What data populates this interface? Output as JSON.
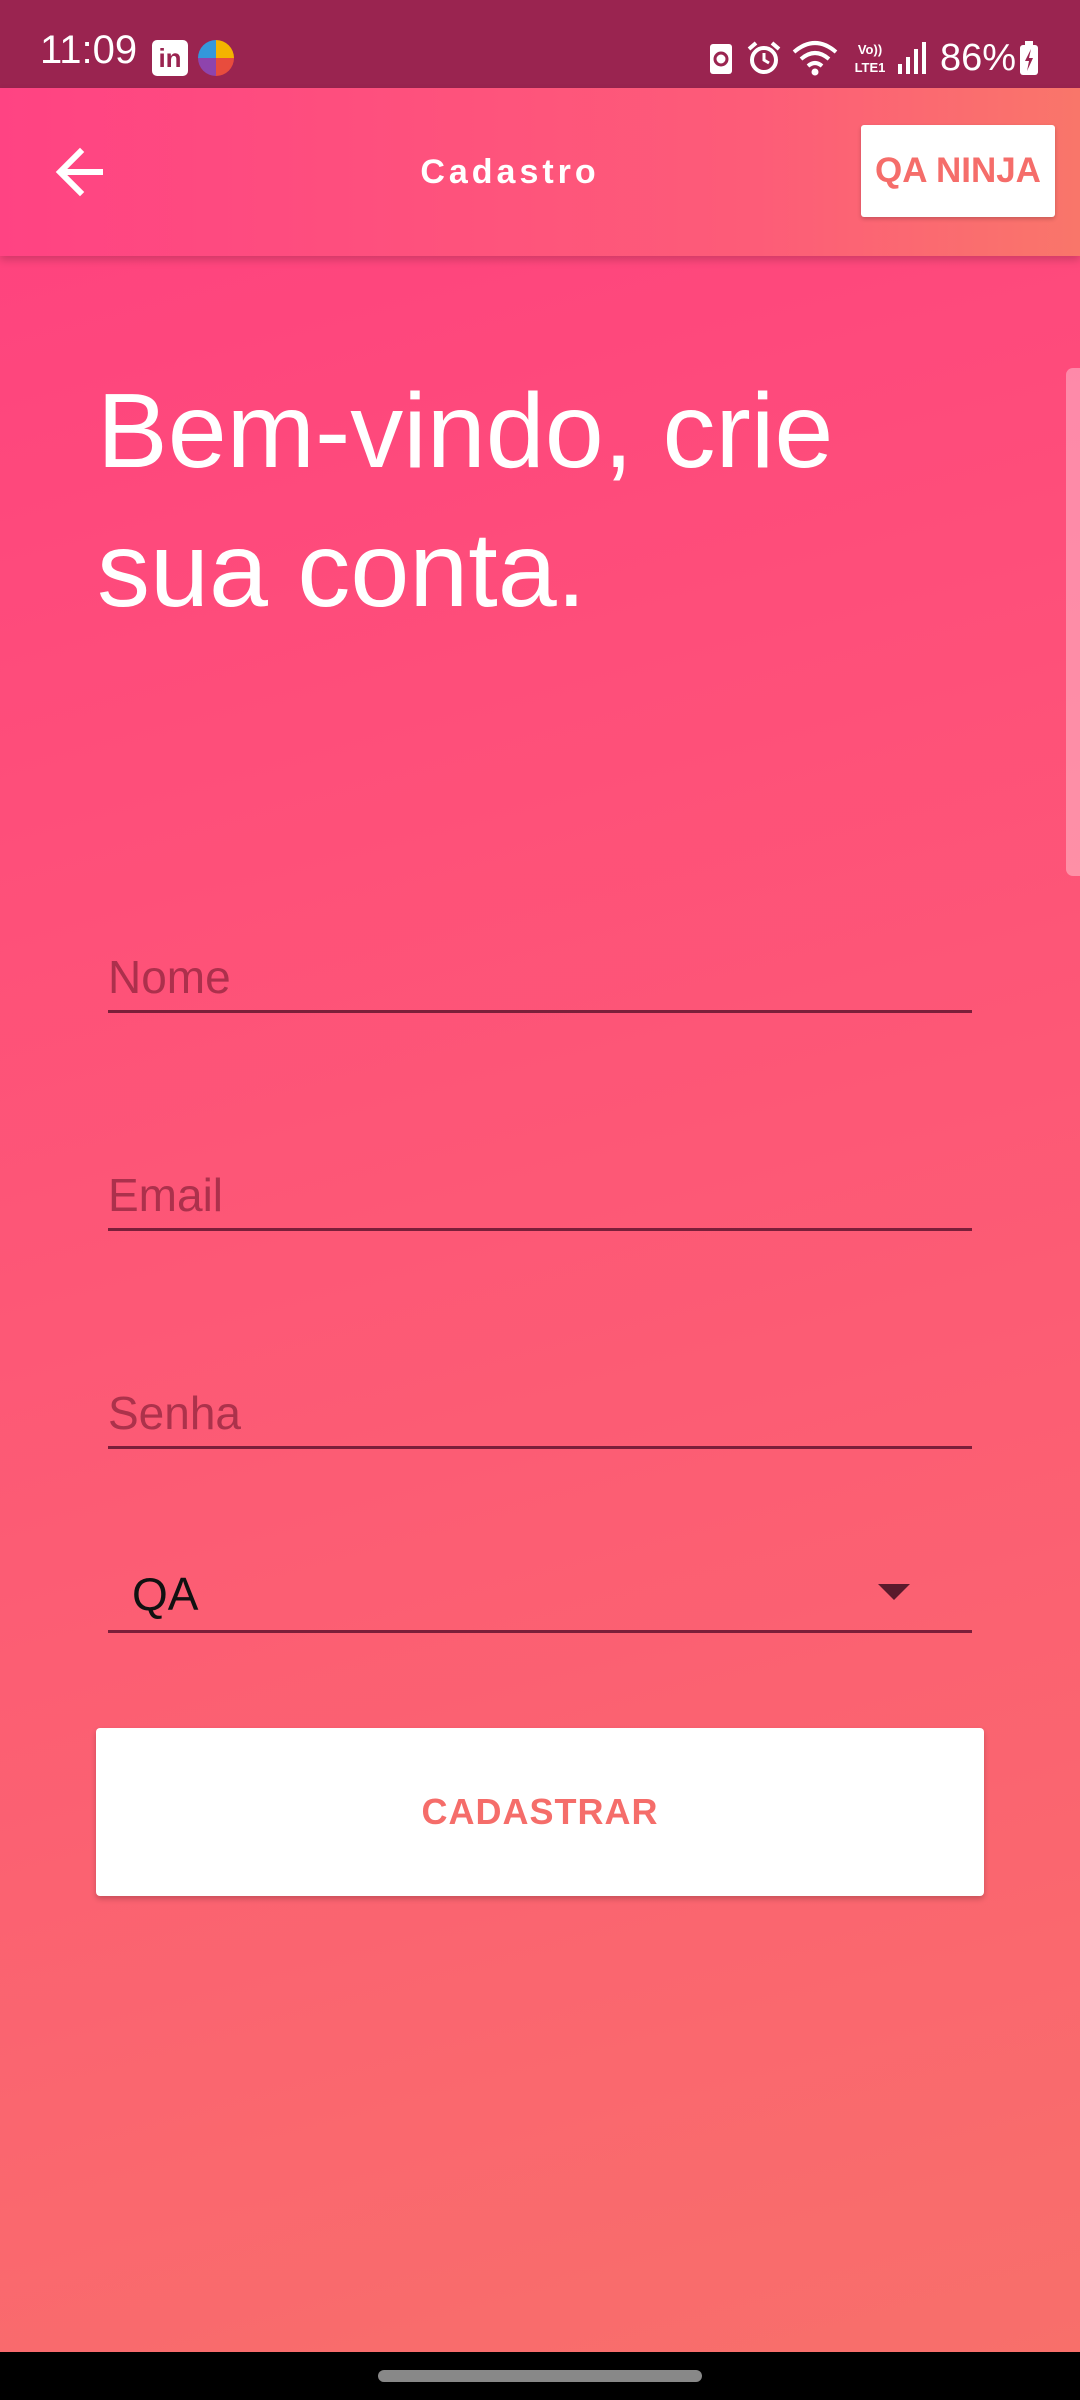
{
  "status_bar": {
    "time": "11:09",
    "battery": "86%",
    "network": "VoLTE1",
    "icons": [
      "linkedin-icon",
      "browser-icon",
      "sync-icon",
      "alarm-icon",
      "wifi-icon",
      "lte-icon",
      "signal-icon",
      "battery-icon"
    ]
  },
  "app_bar": {
    "title": "Cadastro",
    "back_icon": "arrow-left-icon",
    "action_label": "QA NINJA"
  },
  "heading": "Bem-vindo, crie sua conta.",
  "form": {
    "name_placeholder": "Nome",
    "email_placeholder": "Email",
    "password_placeholder": "Senha",
    "role_value": "QA",
    "submit_label": "CADASTRAR"
  },
  "colors": {
    "status_bar": "#9a2450",
    "gradient_start": "#ff3f80",
    "gradient_end": "#f8706a",
    "accent_text": "#f56d6a",
    "underline": "#7a1f3a"
  }
}
